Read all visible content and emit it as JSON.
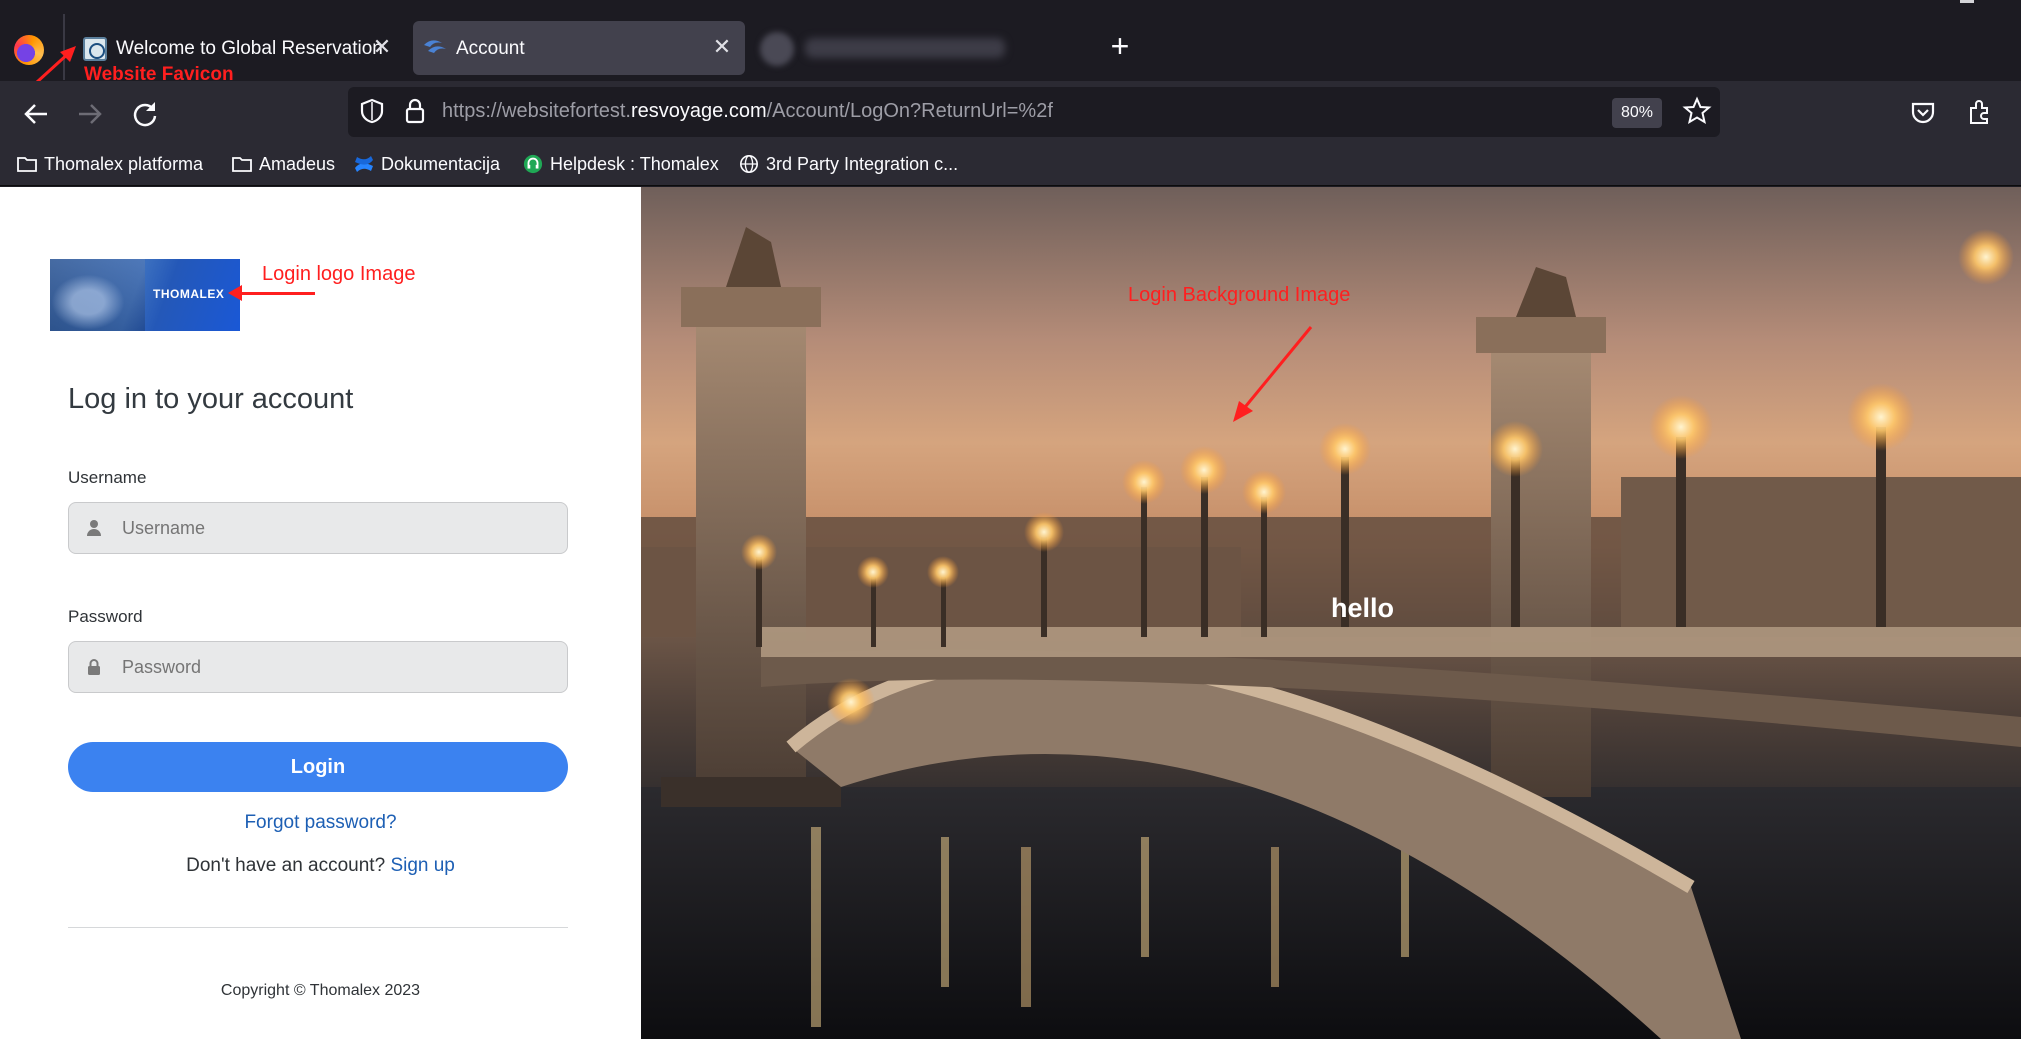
{
  "browser": {
    "tabs": [
      {
        "label": "Welcome to Global Reservation",
        "active": false,
        "favicon": "globe-favicon"
      },
      {
        "label": "Account",
        "active": true,
        "favicon": "thomalex-favicon"
      },
      {
        "label": "",
        "active": false,
        "blurred": true
      }
    ],
    "close_glyph": "✕",
    "new_tab_glyph": "+",
    "url": {
      "prefix": "https://websitefortest.",
      "host": "resvoyage.com",
      "path": "/Account/LogOn?ReturnUrl=%2f"
    },
    "zoom": "80%",
    "bookmarks": [
      {
        "label": "Thomalex platforma",
        "icon": "folder-icon"
      },
      {
        "label": "Amadeus",
        "icon": "folder-icon"
      },
      {
        "label": "Dokumentacija",
        "icon": "confluence-icon"
      },
      {
        "label": "Helpdesk : Thomalex",
        "icon": "headset-icon"
      },
      {
        "label": "3rd Party Integration c...",
        "icon": "globe-icon"
      }
    ]
  },
  "annotations": {
    "favicon": "Website Favicon",
    "logo": "Login logo Image",
    "background": "Login Background Image"
  },
  "login": {
    "logo_text": "THOMALEX",
    "title": "Log in to your account",
    "username_label": "Username",
    "username_placeholder": "Username",
    "password_label": "Password",
    "password_placeholder": "Password",
    "login_button": "Login",
    "forgot": "Forgot password?",
    "no_account": "Don't have an account?",
    "signup": "Sign up",
    "copyright": "Copyright © Thomalex 2023"
  },
  "background": {
    "overlay_text": "hello"
  },
  "colors": {
    "accent": "#3b82f0",
    "link": "#1d5fb4",
    "annotation": "#ff1f1f"
  }
}
